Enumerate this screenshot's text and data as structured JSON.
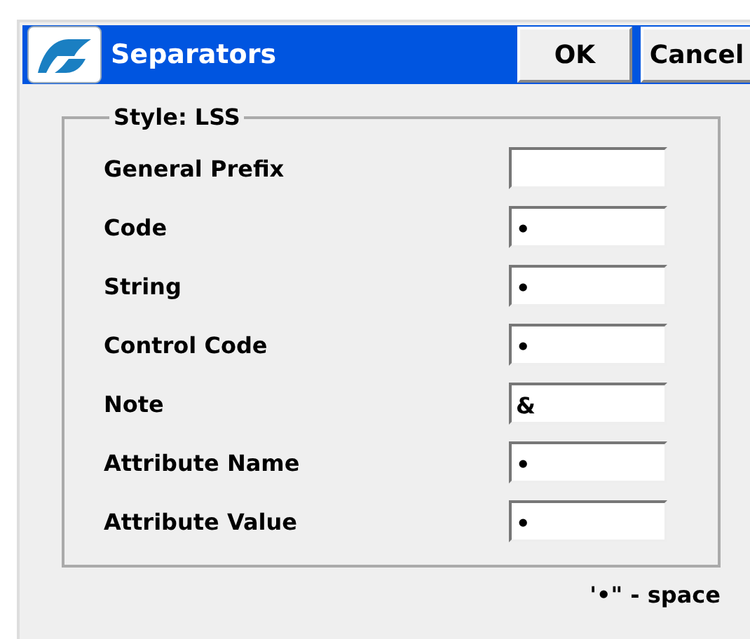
{
  "window": {
    "title": "Separators"
  },
  "buttons": [
    "OK",
    "Cancel"
  ],
  "group": {
    "title": "Style: LSS",
    "fields": [
      {
        "label": "General Prefix"
      },
      {
        "label": "Code",
        "value": "•"
      },
      {
        "label": "String",
        "value": "•"
      },
      {
        "label": "Control Code",
        "value": "•"
      },
      {
        "label": "Note",
        "value": "&"
      },
      {
        "label": "Attribute Name",
        "value": "•"
      },
      {
        "label": "Attribute Value",
        "value": "•"
      }
    ]
  },
  "legend": "'•\" - space"
}
